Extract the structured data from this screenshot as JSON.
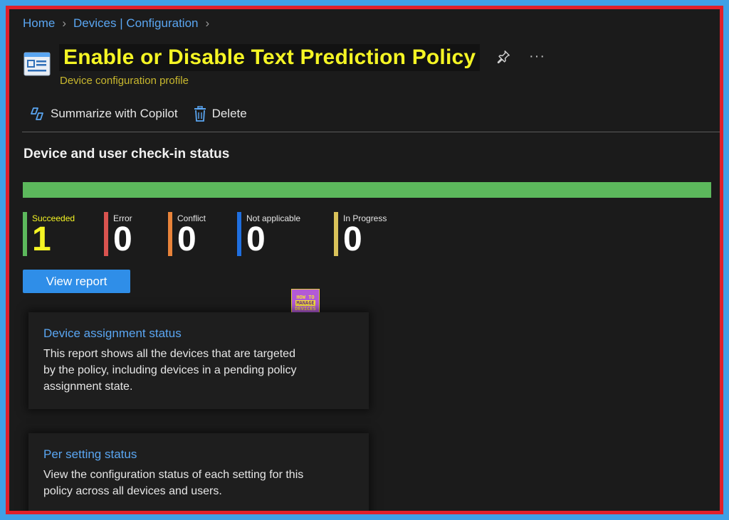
{
  "breadcrumb": {
    "items": [
      "Home",
      "Devices | Configuration"
    ]
  },
  "header": {
    "title": "Enable or Disable Text Prediction Policy",
    "subtitle": "Device configuration profile",
    "more": "···"
  },
  "toolbar": {
    "summarize_label": "Summarize with Copilot",
    "delete_label": "Delete"
  },
  "status": {
    "title": "Device and user check-in status",
    "progress_success_fraction": 1.0,
    "stats": [
      {
        "label": "Succeeded",
        "value": "1",
        "color": "#5cb85c"
      },
      {
        "label": "Error",
        "value": "0",
        "color": "#d9534f"
      },
      {
        "label": "Conflict",
        "value": "0",
        "color": "#e8833a"
      },
      {
        "label": "Not applicable",
        "value": "0",
        "color": "#1f6fe0"
      },
      {
        "label": "In Progress",
        "value": "0",
        "color": "#d9c25a"
      }
    ],
    "view_report_label": "View report"
  },
  "logo": {
    "line1": "HOW TO",
    "line2": "MANAGE",
    "line3": "DEVICES"
  },
  "cards": [
    {
      "title": "Device assignment status",
      "body": "This report shows all the devices that are targeted by the policy, including devices in a pending policy assignment state."
    },
    {
      "title": "Per setting status",
      "body": "View the configuration status of each setting for this policy across all devices and users."
    }
  ],
  "colors": {
    "accent": "#2f8ee8",
    "title_highlight": "#f5f524",
    "frame_border": "#e0202a",
    "outer_bg": "#3fa0e6"
  }
}
